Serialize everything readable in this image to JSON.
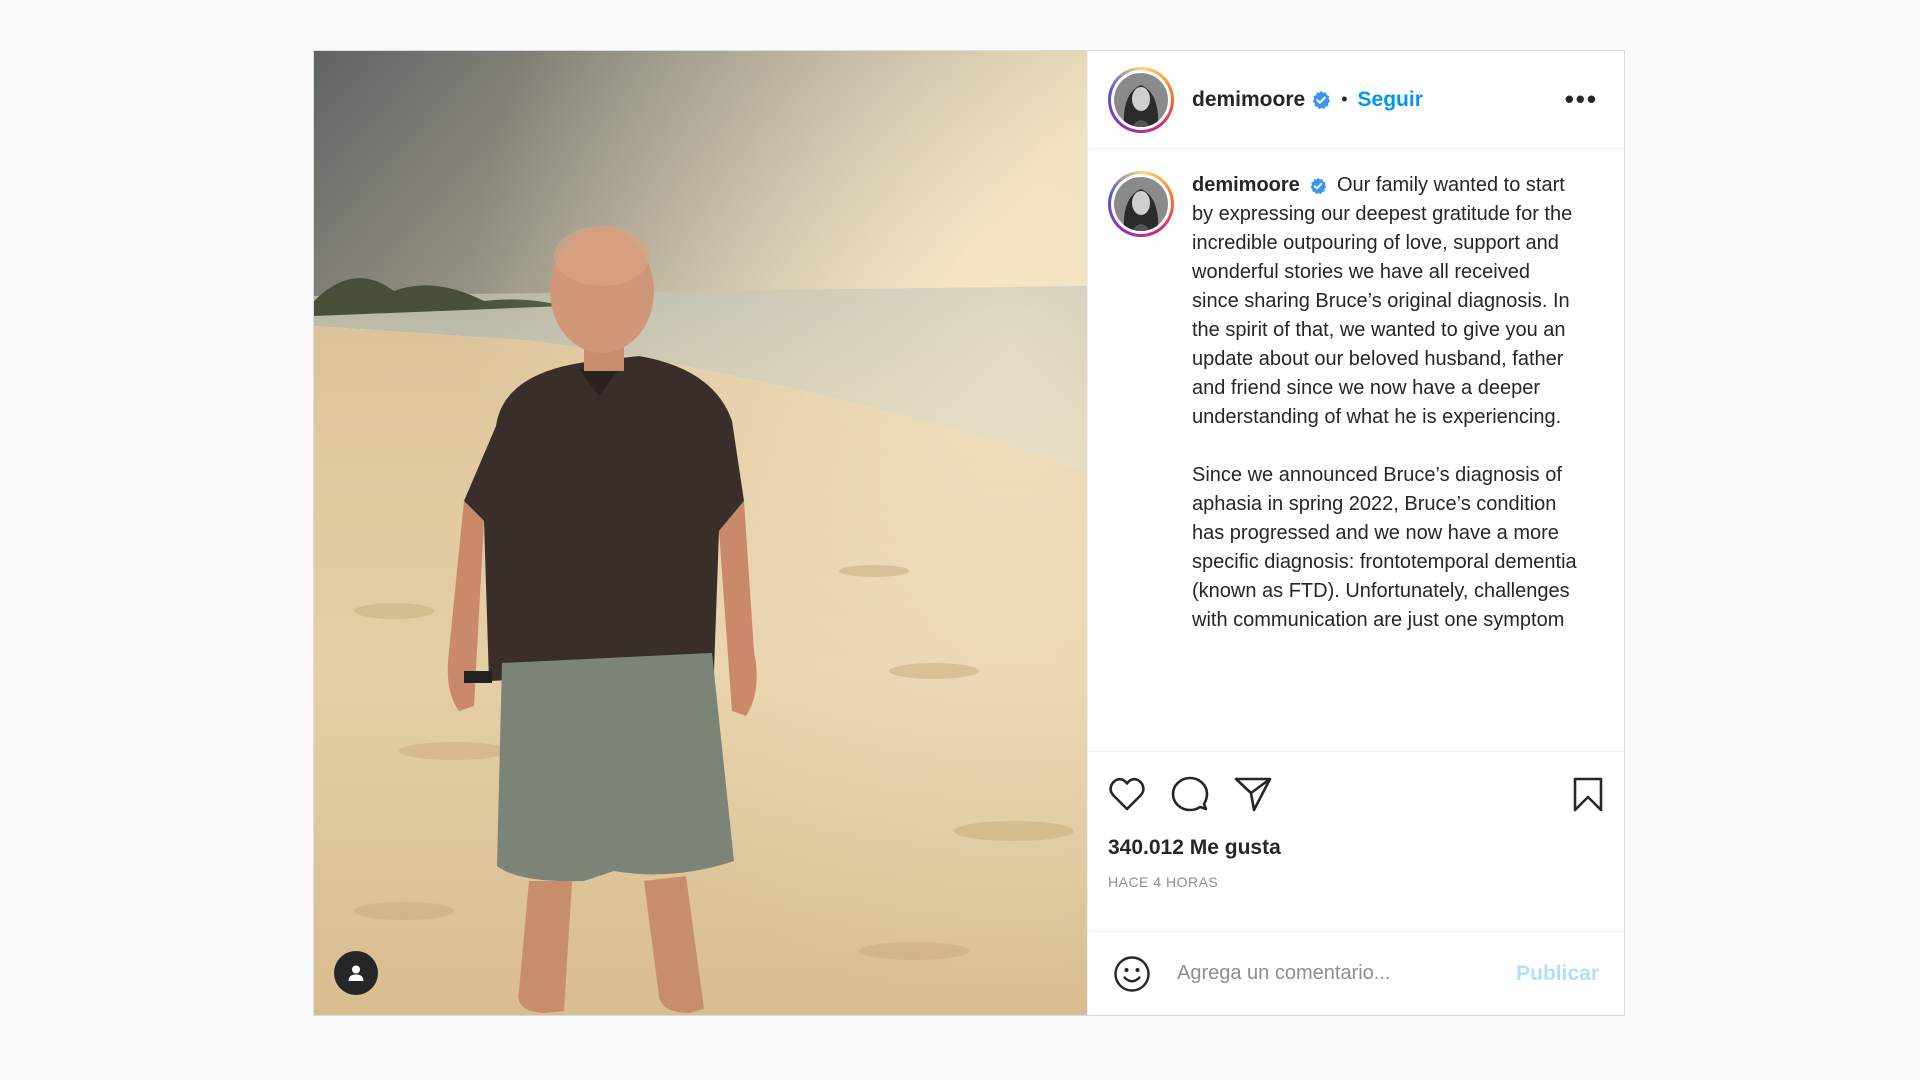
{
  "post": {
    "author": {
      "username": "demimoore",
      "verified": true,
      "follow_label": "Seguir",
      "separator": "•"
    },
    "more_options_label": "•••",
    "caption": {
      "username": "demimoore",
      "paragraph_1": "Our family wanted to start by expressing our deepest gratitude for the incredible outpouring of love, support and wonderful stories we have all received since sharing Bruce’s original diagnosis. In the spirit of that, we wanted to give you an update about our beloved husband, father and friend since we now have a deeper understanding of what he is experiencing.",
      "paragraph_2": "Since we announced Bruce’s diagnosis of aphasia in spring 2022, Bruce’s condition has progressed and we now have a more specific diagnosis: frontotemporal dementia (known as FTD). Unfortunately, challenges with communication are just one symptom"
    },
    "likes_text": "340.012 Me gusta",
    "timestamp": "HACE 4 HORAS",
    "comment": {
      "placeholder": "Agrega un comentario...",
      "publish_label": "Publicar"
    },
    "icons": {
      "like": "heart-icon",
      "comment": "comment-icon",
      "share": "share-icon",
      "save": "bookmark-icon",
      "emoji": "emoji-icon",
      "tag": "user-tag-icon",
      "verified": "verified-badge-icon"
    },
    "colors": {
      "link_blue": "#0095f6",
      "publish_disabled": "#b2dffc",
      "verified_blue": "#3897f0",
      "text": "#262626",
      "muted": "#8e8e8e"
    }
  }
}
